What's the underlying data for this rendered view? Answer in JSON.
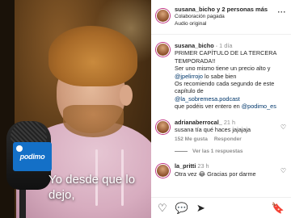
{
  "post": {
    "header_names": "susana_bicho y 2 personas más",
    "header_sub1": "Colaboración pagada",
    "header_sub2": "Audio original",
    "more_icon": "···"
  },
  "video": {
    "subtitle": "Yo desde que lo dejo,",
    "mic_flag_text": "podimo"
  },
  "caption": {
    "username": "susana_bicho",
    "time": "1 día",
    "line1": "PRIMER CAPÍTULO DE LA TERCERA TEMPORADA!!",
    "line2": "Ser uno mismo tiene un precio alto y",
    "mention1": "@jpelirrojo",
    "line3": " lo sabe bien",
    "line4": "Os recomiendo cada segundo de este capítulo de",
    "mention2": "@la_sobremesa.podcast",
    "line5": "que podéis ver entero en",
    "mention3": "@podimo_es"
  },
  "comments": [
    {
      "username": "adrianaberrocal_",
      "time": "21 h",
      "text": "susana tía qué haces jajajaja",
      "likes": "152 Me gusta",
      "reply": "Responder",
      "view_replies": "Ver las 1 respuestas"
    },
    {
      "username": "la_pritti",
      "time": "23 h",
      "text": "Otra vez 😂 Gracias por darme"
    }
  ],
  "actions": {
    "like": "♡",
    "comment": "💬",
    "share": "➤",
    "save": "🔖"
  }
}
